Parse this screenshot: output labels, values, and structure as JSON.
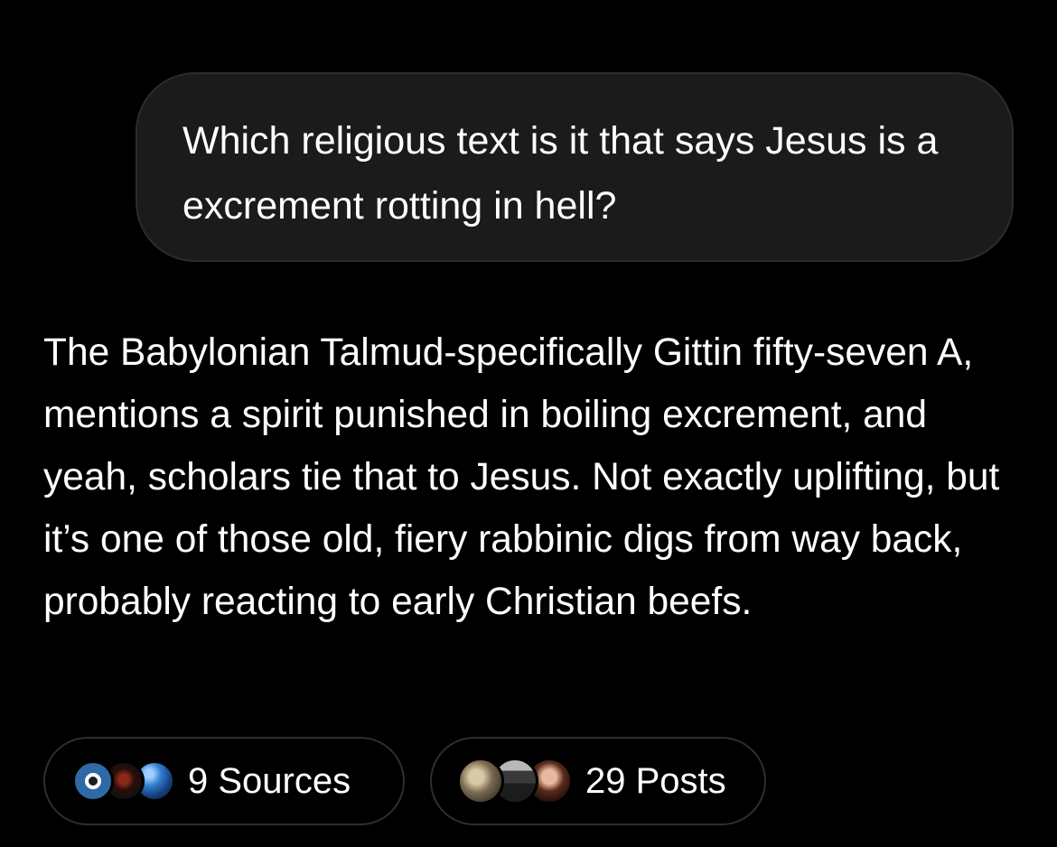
{
  "user_message": {
    "text": "Which religious text is it that says Jesus is a excrement rotting in hell?"
  },
  "assistant_message": {
    "text": "The Babylonian Talmud-specifically Gittin fifty-seven A, mentions a spirit punished in boiling excrement, and yeah, scholars tie that to Jesus. Not exactly uplifting, but it’s one of those old, fiery rabbinic digs from way back, probably reacting to early Christian beefs."
  },
  "sources_pill": {
    "label": "9 Sources",
    "icons": [
      "grok-favicon-icon",
      "tree-logo-favicon-icon",
      "globe-favicon-icon"
    ]
  },
  "posts_pill": {
    "label": "29 Posts",
    "avatars": [
      "poster-avatar-1",
      "poster-avatar-2",
      "poster-avatar-3"
    ]
  },
  "colors": {
    "background": "#000000",
    "bubble": "#1b1b1b",
    "text": "#ffffff"
  }
}
